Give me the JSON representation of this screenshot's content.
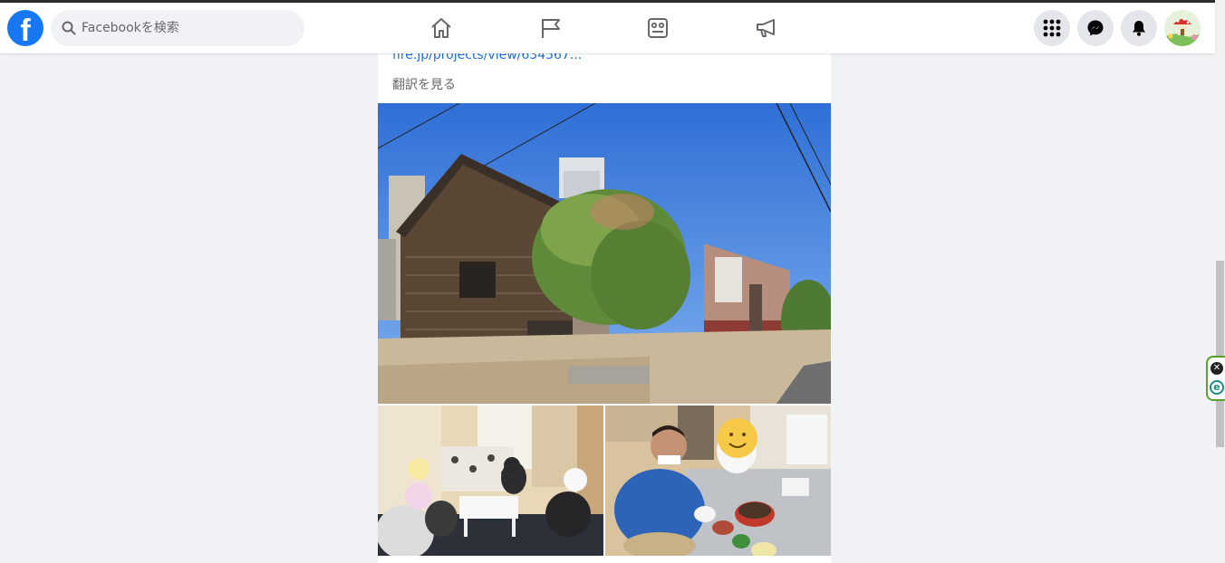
{
  "header": {
    "logo_letter": "f",
    "search_placeholder": "Facebookを検索",
    "nav": [
      "home-icon",
      "pages-flag-icon",
      "gaming-icon",
      "ads-megaphone-icon"
    ],
    "right_buttons": [
      "menu-grid-icon",
      "messenger-icon",
      "notifications-bell-icon"
    ],
    "brand_color": "#1877f2"
  },
  "post": {
    "link_text": "fire.jp/projects/view/634567...",
    "translate_label": "翻訳を見る"
  },
  "extension": {
    "close_glyph": "✕",
    "logo_letter": "e"
  }
}
